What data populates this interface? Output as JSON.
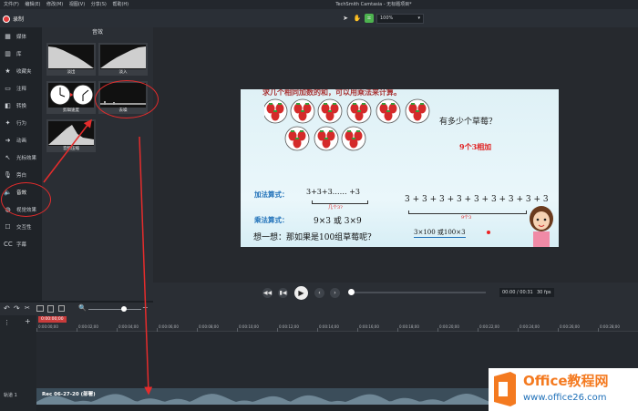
{
  "menu": [
    "文件(F)",
    "编辑(E)",
    "修改(M)",
    "视图(V)",
    "分享(S)",
    "帮助(H)"
  ],
  "window_title": "TechSmith Camtasia - 无标题项目*",
  "record_label": "录制",
  "zoom_value": "100%",
  "sidebar": [
    {
      "label": "媒体",
      "icon": "film-icon"
    },
    {
      "label": "库",
      "icon": "library-icon"
    },
    {
      "label": "收藏夹",
      "icon": "star-icon"
    },
    {
      "label": "注释",
      "icon": "annotation-icon"
    },
    {
      "label": "转换",
      "icon": "transition-icon"
    },
    {
      "label": "行为",
      "icon": "behavior-icon"
    },
    {
      "label": "动画",
      "icon": "animation-icon"
    },
    {
      "label": "光标效果",
      "icon": "cursor-icon"
    },
    {
      "label": "旁白",
      "icon": "mic-icon"
    },
    {
      "label": "音效",
      "icon": "speaker-icon"
    },
    {
      "label": "视觉效果",
      "icon": "visual-icon"
    },
    {
      "label": "交互性",
      "icon": "interactive-icon"
    },
    {
      "label": "字幕",
      "icon": "cc-icon"
    }
  ],
  "panel": {
    "title": "音效",
    "effects": [
      "淡出",
      "淡入",
      "剪辑速度",
      "去噪",
      "音频压缩"
    ]
  },
  "slide": {
    "top_text": "求几个相同加数的和，可以用乘法来计算。",
    "question": "有多少个草莓？",
    "times_label": "9个3相加",
    "add_label": "加法算式：",
    "add_expr": "3+3+3……  +3",
    "add_note": "几个3?",
    "long_sum": "3 + 3 + 3 + 3 + 3 + 3 + 3 + 3 + 3",
    "sum_note": "9个3",
    "mul_label": "乘法算式：",
    "mul_expr": "9×3  或  3×9",
    "think": "想一想：那如果是100组草莓呢？",
    "hundred": "3×100  或100×3"
  },
  "player": {
    "time": "00:00 / 00:31",
    "fps": "30 fps"
  },
  "timeline": {
    "playhead": "0:00:00;00",
    "ticks": [
      "0:00:00;00",
      "0:00:02;00",
      "0:00:04;00",
      "0:00:06;00",
      "0:00:08;00",
      "0:00:10;00",
      "0:00:12;00",
      "0:00:14;00",
      "0:00:16;00",
      "0:00:18;00",
      "0:00:20;00",
      "0:00:22;00",
      "0:00:24;00",
      "0:00:26;00",
      "0:00:28;00"
    ],
    "track_label": "轨道 1",
    "clip_label": "Rec 06-27-20 (部署)"
  },
  "watermark": {
    "brand": "Office教程网",
    "url": "www.office26.com"
  },
  "colors": {
    "accent": "#4db34f",
    "record": "#e33b3b",
    "callout": "#e52c2c",
    "brand_orange": "#f47a20",
    "brand_blue": "#1d6fb8"
  }
}
